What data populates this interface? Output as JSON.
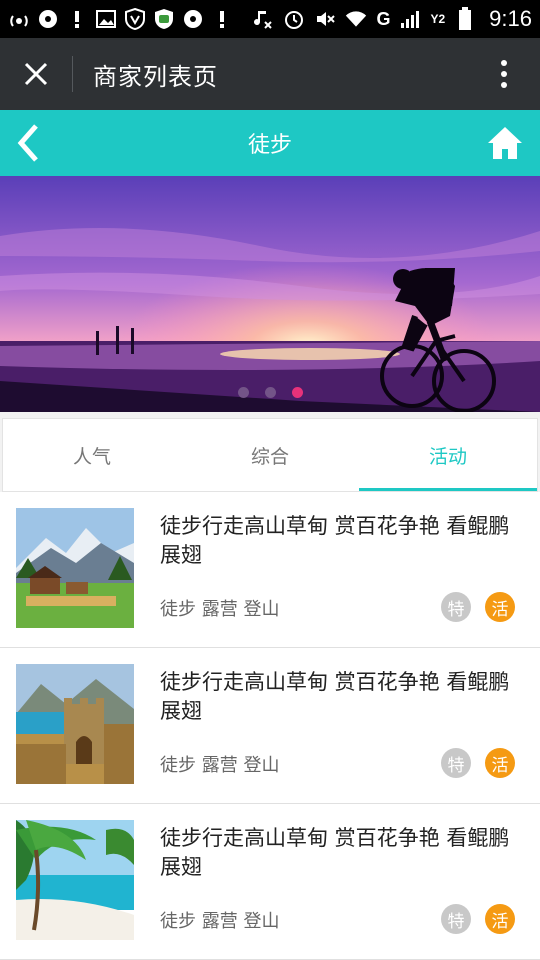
{
  "status_bar": {
    "network_label": "G",
    "sim_label": "Y2",
    "time": "9:16"
  },
  "app_bar": {
    "title": "商家列表页",
    "close_icon": "close-icon",
    "more_icon": "more-vertical-icon"
  },
  "nav": {
    "title": "徒步",
    "back_icon": "chevron-left-icon",
    "home_icon": "home-icon"
  },
  "banner": {
    "slide_count": 3,
    "active_index": 2
  },
  "tabs": [
    {
      "label": "人气",
      "active": false
    },
    {
      "label": "综合",
      "active": false
    },
    {
      "label": "活动",
      "active": true
    }
  ],
  "items": [
    {
      "title": "徒步行走高山草甸 赏百花争艳 看鲲鹏展翅",
      "tags": "徒步 露营 登山",
      "badge_special": "特",
      "badge_activity": "活"
    },
    {
      "title": "徒步行走高山草甸 赏百花争艳 看鲲鹏展翅",
      "tags": "徒步 露营 登山",
      "badge_special": "特",
      "badge_activity": "活"
    },
    {
      "title": "徒步行走高山草甸 赏百花争艳 看鲲鹏展翅",
      "tags": "徒步 露营 登山",
      "badge_special": "特",
      "badge_activity": "活"
    }
  ],
  "colors": {
    "accent": "#1ec8c4",
    "app_bar": "#2e3134",
    "badge_activity": "#f59a13",
    "badge_special": "#c8c8c8",
    "dot_active": "#e8327a"
  }
}
